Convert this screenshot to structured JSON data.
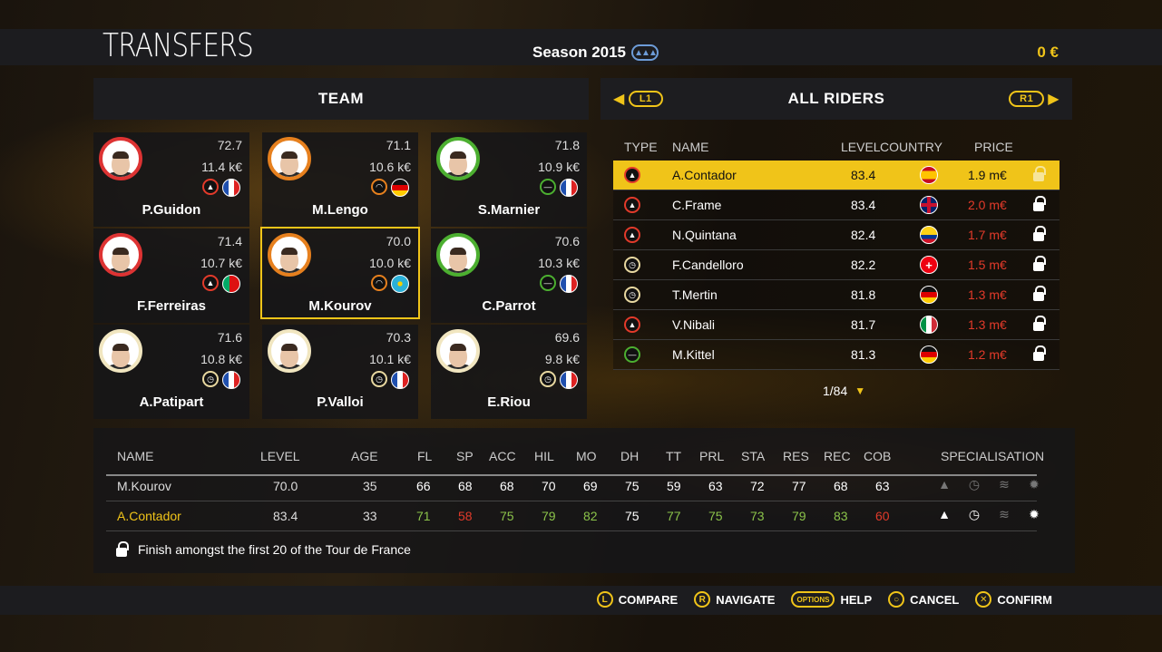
{
  "header": {
    "title": "TRANSFERS",
    "season": "Season 2015",
    "money": "0 €"
  },
  "team_panel": {
    "title": "TEAM"
  },
  "riders_panel": {
    "title": "ALL RIDERS",
    "left_btn": "L1",
    "right_btn": "R1",
    "pager": "1/84"
  },
  "team": [
    {
      "name": "P.Guidon",
      "level": "72.7",
      "value": "11.4 k€",
      "type": "climb",
      "ring": "red"
    },
    {
      "name": "M.Lengo",
      "level": "71.1",
      "value": "10.6 k€",
      "type": "hill",
      "ring": "orange"
    },
    {
      "name": "S.Marnier",
      "level": "71.8",
      "value": "10.9 k€",
      "type": "sprint",
      "ring": "green"
    },
    {
      "name": "F.Ferreiras",
      "level": "71.4",
      "value": "10.7 k€",
      "type": "climb",
      "ring": "red"
    },
    {
      "name": "M.Kourov",
      "level": "70.0",
      "value": "10.0 k€",
      "type": "hill",
      "ring": "orange"
    },
    {
      "name": "C.Parrot",
      "level": "70.6",
      "value": "10.3 k€",
      "type": "sprint",
      "ring": "green"
    },
    {
      "name": "A.Patipart",
      "level": "71.6",
      "value": "10.8 k€",
      "type": "tt",
      "ring": "cream"
    },
    {
      "name": "P.Valloi",
      "level": "70.3",
      "value": "10.1 k€",
      "type": "tt",
      "ring": "cream"
    },
    {
      "name": "E.Riou",
      "level": "69.6",
      "value": "9.8 k€",
      "type": "tt",
      "ring": "cream"
    }
  ],
  "riders_table": {
    "columns": {
      "type": "TYPE",
      "name": "NAME",
      "level": "LEVEL",
      "country": "COUNTRY",
      "price": "PRICE"
    },
    "rows": [
      {
        "name": "A.Contador",
        "level": "83.4",
        "price": "1.9 m€",
        "type": "climb"
      },
      {
        "name": "C.Frame",
        "level": "83.4",
        "price": "2.0 m€",
        "type": "climb"
      },
      {
        "name": "N.Quintana",
        "level": "82.4",
        "price": "1.7 m€",
        "type": "climb"
      },
      {
        "name": "F.Candelloro",
        "level": "82.2",
        "price": "1.5 m€",
        "type": "tt"
      },
      {
        "name": "T.Mertin",
        "level": "81.8",
        "price": "1.3 m€",
        "type": "tt"
      },
      {
        "name": "V.Nibali",
        "level": "81.7",
        "price": "1.3 m€",
        "type": "climb"
      },
      {
        "name": "M.Kittel",
        "level": "81.3",
        "price": "1.2 m€",
        "type": "sprint"
      }
    ]
  },
  "comparison": {
    "columns": [
      "NAME",
      "LEVEL",
      "AGE",
      "FL",
      "SP",
      "ACC",
      "HIL",
      "MO",
      "DH",
      "TT",
      "PRL",
      "STA",
      "RES",
      "REC",
      "COB",
      "SPECIALISATION"
    ],
    "rows": [
      [
        "M.Kourov",
        "70.0",
        "35",
        "66",
        "68",
        "68",
        "70",
        "69",
        "75",
        "59",
        "63",
        "72",
        "77",
        "68",
        "63"
      ],
      [
        "A.Contador",
        "83.4",
        "33",
        "71",
        "58",
        "75",
        "79",
        "82",
        "75",
        "77",
        "75",
        "73",
        "79",
        "83",
        "60"
      ]
    ],
    "note": "Finish amongst the first 20 of the Tour de France"
  },
  "actions": {
    "compare": "COMPARE",
    "compare_key": "L",
    "navigate": "NAVIGATE",
    "navigate_key": "R",
    "help": "HELP",
    "help_key": "OPTIONS",
    "cancel": "CANCEL",
    "confirm": "CONFIRM"
  },
  "colors": {
    "accent": "#f0c419",
    "price_red": "#e23a2a",
    "good_green": "#8bc34a"
  }
}
